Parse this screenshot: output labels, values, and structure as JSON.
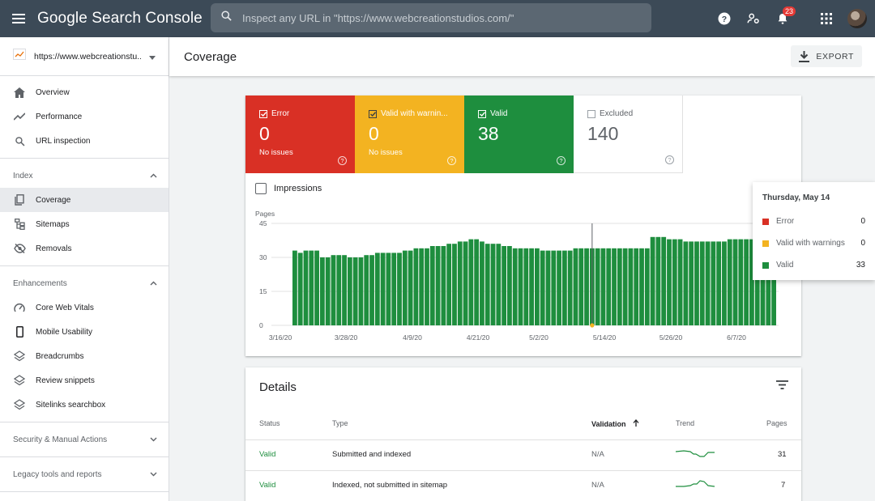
{
  "app": {
    "title": "Google Search Console",
    "search_placeholder": "Inspect any URL in \"https://www.webcreationstudios.com/\"",
    "notification_count": "23"
  },
  "sidebar": {
    "property": "https://www.webcreationstu...",
    "top_items": [
      {
        "label": "Overview",
        "icon": "home-icon"
      },
      {
        "label": "Performance",
        "icon": "trending-up-icon"
      },
      {
        "label": "URL inspection",
        "icon": "search-icon"
      }
    ],
    "index": {
      "title": "Index",
      "items": [
        {
          "label": "Coverage",
          "icon": "coverage-icon",
          "active": true
        },
        {
          "label": "Sitemaps",
          "icon": "sitemap-icon"
        },
        {
          "label": "Removals",
          "icon": "eye-off-icon"
        }
      ]
    },
    "enhancements": {
      "title": "Enhancements",
      "items": [
        {
          "label": "Core Web Vitals",
          "icon": "speedometer-icon"
        },
        {
          "label": "Mobile Usability",
          "icon": "phone-icon"
        },
        {
          "label": "Breadcrumbs",
          "icon": "layers-icon"
        },
        {
          "label": "Review snippets",
          "icon": "layers-icon"
        },
        {
          "label": "Sitelinks searchbox",
          "icon": "layers-icon"
        }
      ]
    },
    "security_title": "Security & Manual Actions",
    "legacy_title": "Legacy tools and reports"
  },
  "header": {
    "title": "Coverage",
    "export_label": "EXPORT"
  },
  "tiles": [
    {
      "label": "Error",
      "value": "0",
      "sub": "No issues",
      "color": "#d93025"
    },
    {
      "label": "Valid with warnin...",
      "value": "0",
      "sub": "No issues",
      "color": "#f3b321"
    },
    {
      "label": "Valid",
      "value": "38",
      "sub": "",
      "color": "#1e8e3e"
    },
    {
      "label": "Excluded",
      "value": "140",
      "sub": "",
      "color": "#ffffff"
    }
  ],
  "impressions_label": "Impressions",
  "chart_data": {
    "type": "bar",
    "ylabel": "Pages",
    "yticks": [
      "0",
      "15",
      "30",
      "45"
    ],
    "ylim": [
      0,
      45
    ],
    "x_tick_labels": [
      "3/16/20",
      "3/28/20",
      "4/9/20",
      "4/21/20",
      "5/2/20",
      "5/14/20",
      "5/26/20",
      "6/7/20"
    ],
    "series": [
      {
        "name": "Valid",
        "color": "#1e8e3e",
        "values": [
          33,
          32,
          33,
          33,
          33,
          30,
          30,
          31,
          31,
          31,
          30,
          30,
          30,
          31,
          31,
          32,
          32,
          32,
          32,
          32,
          33,
          33,
          34,
          34,
          34,
          35,
          35,
          35,
          36,
          36,
          37,
          37,
          38,
          38,
          37,
          36,
          36,
          36,
          35,
          35,
          34,
          34,
          34,
          34,
          34,
          33,
          33,
          33,
          33,
          33,
          33,
          34,
          34,
          34,
          34,
          34,
          34,
          34,
          34,
          34,
          34,
          34,
          34,
          34,
          34,
          39,
          39,
          39,
          38,
          38,
          38,
          37,
          37,
          37,
          37,
          37,
          37,
          37,
          37,
          38,
          38,
          38,
          38,
          38,
          38,
          38,
          38,
          38
        ]
      },
      {
        "name": "Error",
        "color": "#d93025",
        "values": [
          0
        ]
      },
      {
        "name": "Valid with warnings",
        "color": "#f3b321",
        "values": [
          0
        ]
      }
    ],
    "hover_index": 54
  },
  "tooltip": {
    "date": "Thursday, May 14",
    "rows": [
      {
        "label": "Error",
        "value": "0",
        "color": "#d93025"
      },
      {
        "label": "Valid with warnings",
        "value": "0",
        "color": "#f3b321"
      },
      {
        "label": "Valid",
        "value": "33",
        "color": "#1e8e3e"
      }
    ]
  },
  "details": {
    "title": "Details",
    "columns": {
      "status": "Status",
      "type": "Type",
      "validation": "Validation",
      "trend": "Trend",
      "pages": "Pages"
    },
    "rows": [
      {
        "status": "Valid",
        "type": "Submitted and indexed",
        "validation": "N/A",
        "pages": "31"
      },
      {
        "status": "Valid",
        "type": "Indexed, not submitted in sitemap",
        "validation": "N/A",
        "pages": "7"
      }
    ]
  }
}
